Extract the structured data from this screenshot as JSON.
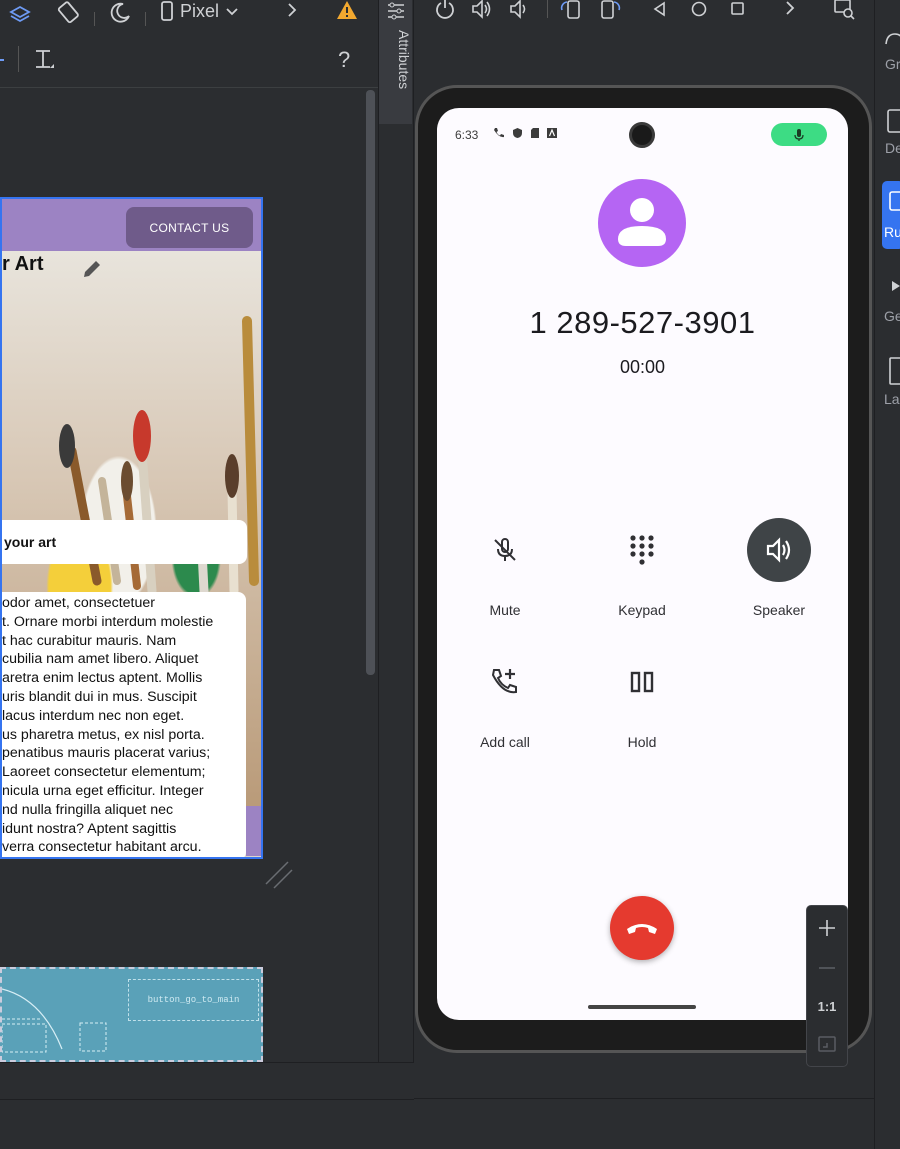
{
  "toolbar": {
    "device_label": "Pixel",
    "help_label": "?"
  },
  "attributes_tab": {
    "label": "Attributes"
  },
  "app_preview": {
    "contact_button": "CONTACT US",
    "title": "r Art",
    "card_label": "your art",
    "body_lines": [
      " odor amet, consectetuer",
      "t. Ornare morbi interdum molestie",
      "t hac curabitur mauris. Nam",
      " cubilia nam amet libero. Aliquet",
      "aretra enim lectus aptent. Mollis",
      "uris blandit dui in mus. Suscipit",
      "lacus interdum nec non eget.",
      "us pharetra metus, ex nisl porta.",
      "penatibus mauris placerat varius;",
      "Laoreet consectetur elementum;",
      "nicula urna eget efficitur. Integer",
      "nd nulla fringilla aliquet nec",
      "idunt nostra? Aptent sagittis",
      "verra consectetur habitant arcu."
    ]
  },
  "nav_preview": {
    "button_id": "button_go_to_main"
  },
  "phone": {
    "status_time": "6:33",
    "phone_number": "1 289-527-3901",
    "call_timer": "00:00",
    "controls": {
      "mute": "Mute",
      "keypad": "Keypad",
      "speaker": "Speaker",
      "add_call": "Add call",
      "hold": "Hold"
    }
  },
  "zoom": {
    "one_to_one": "1:1"
  },
  "right_strip": {
    "items": [
      "Gr",
      "De",
      "Ru",
      "Ge",
      "La"
    ]
  },
  "colors": {
    "ide_bg": "#2b2d30",
    "accent_blue": "#3574f0",
    "avatar_purple": "#b565f3",
    "end_call_red": "#e53a2f",
    "mic_green": "#3ddc84",
    "speaker_active": "#3f4447",
    "app_header_purple": "#9c83c3"
  }
}
